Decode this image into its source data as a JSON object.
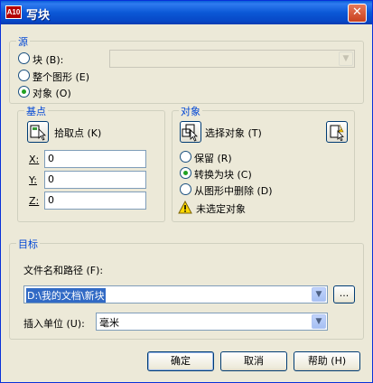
{
  "window": {
    "title": "写块",
    "app_icon_text": "A10",
    "close_glyph": "✕"
  },
  "source": {
    "legend": "源",
    "block_label": "块 (B):",
    "entire_drawing_label": "整个图形 (E)",
    "objects_label": "对象 (O)",
    "selected": "objects",
    "block_combo_value": ""
  },
  "base_point": {
    "legend": "基点",
    "pick_point_label": "拾取点 (K)",
    "x_label": "X:",
    "x_value": "0",
    "y_label": "Y:",
    "y_value": "0",
    "z_label": "Z:",
    "z_value": "0"
  },
  "objects": {
    "legend": "对象",
    "select_objects_label": "选择对象 (T)",
    "retain_label": "保留 (R)",
    "convert_label": "转换为块 (C)",
    "delete_label": "从图形中删除 (D)",
    "selected": "convert",
    "warning_text": "未选定对象"
  },
  "destination": {
    "legend": "目标",
    "filename_label": "文件名和路径 (F):",
    "filename_value": "D:\\我的文档\\新块",
    "browse_label": "...",
    "units_label": "插入单位 (U):",
    "units_value": "毫米"
  },
  "buttons": {
    "ok": "确定",
    "cancel": "取消",
    "help": "帮助 (H)"
  },
  "colors": {
    "titlebar": "#0a5fd8",
    "legend": "#0046d5",
    "selection": "#316ac5",
    "radio_dot": "#21a121"
  }
}
